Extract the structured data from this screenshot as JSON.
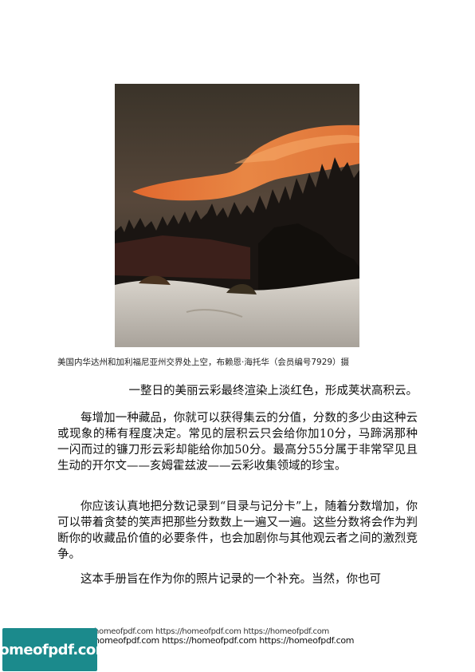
{
  "figure": {
    "caption": "美国内华达州和加利福尼亚州交界处上空，布赖恩·海托华（会员编号7929）摄"
  },
  "body": {
    "lead": "一整日的美丽云彩最终渲染上淡红色，形成荚状高积云。",
    "paragraphs": [
      "每增加一种藏品，你就可以获得集云的分值，分数的多少由这种云或现象的稀有程度决定。常见的层积云只会给你加10分，马蹄涡那种一闪而过的镰刀形云彩却能给你加50分。最高分55分属于非常罕见且生动的开尔文——亥姆霍兹波——云彩收集领域的珍宝。",
      "你应该认真地把分数记录到“目录与记分卡”上，随着分数增加，你可以带着贪婪的笑声把那些分数数上一遍又一遍。这些分数将会作为判断你的收藏品价值的必要条件，也会加剧你与其他观云者之间的激烈竞争。",
      "这本手册旨在作为你的照片记录的一个补充。当然，你也可"
    ]
  },
  "watermark": {
    "line1": "homeofpdf.com https://homeofpdf.com https://homeofpdf.com",
    "line2": "homeofpdf.com https://homeofpdf.com https://homeofpdf.com",
    "badge": "homeofpdf.com",
    "badge_color": "#1b8a8c"
  }
}
